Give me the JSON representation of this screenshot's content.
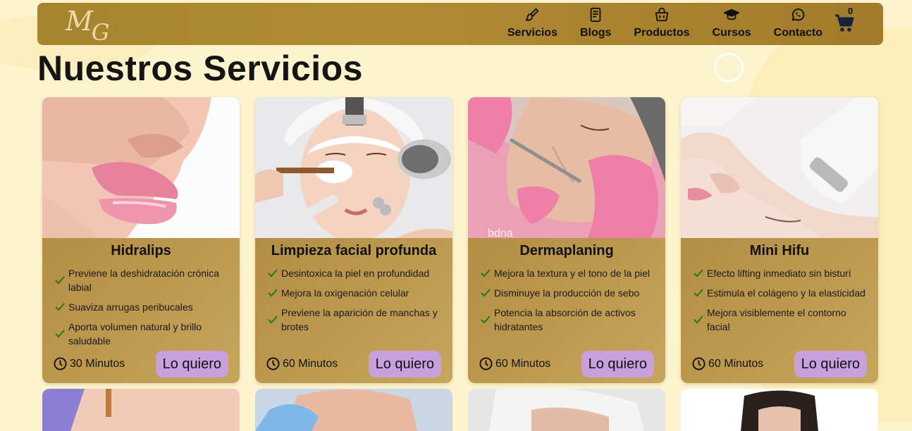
{
  "brand": {
    "logo_text": "M",
    "logo_text2": "G"
  },
  "nav": {
    "items": [
      {
        "label": "Servicios",
        "icon": "brush-icon"
      },
      {
        "label": "Blogs",
        "icon": "book-icon"
      },
      {
        "label": "Productos",
        "icon": "bag-icon"
      },
      {
        "label": "Cursos",
        "icon": "graduation-cap-icon"
      },
      {
        "label": "Contacto",
        "icon": "whatsapp-icon"
      }
    ],
    "cart_count": "0"
  },
  "page": {
    "title": "Nuestros Servicios"
  },
  "services": [
    {
      "title": "Hidralips",
      "benefits": [
        "Previene la deshidratación crónica labial",
        "Suaviza arrugas peribucales",
        "Aporta volumen natural y brillo saludable"
      ],
      "duration": "30 Minutos",
      "cta": "Lo quiero"
    },
    {
      "title": "Limpieza facial profunda",
      "benefits": [
        "Desintoxica la piel en profundidad",
        "Mejora la oxigenación celular",
        "Previene la aparición de manchas y brotes"
      ],
      "duration": "60 Minutos",
      "cta": "Lo quiero"
    },
    {
      "title": "Dermaplaning",
      "benefits": [
        "Mejora la textura y el tono de la piel",
        "Disminuye la producción de sebo",
        "Potencia la absorción de activos hidratantes"
      ],
      "duration": "60 Minutos",
      "cta": "Lo quiero"
    },
    {
      "title": "Mini Hifu",
      "benefits": [
        "Efecto lifting inmediato sin bisturí",
        "Estimula el colágeno y la elasticidad",
        "Mejora visiblemente el contorno facial"
      ],
      "duration": "60 Minutos",
      "cta": "Lo quiero"
    }
  ],
  "colors": {
    "accent": "#c7a0dd",
    "gold": "#a8842f",
    "background": "#fdf3cc",
    "check": "#1f7a1f"
  }
}
